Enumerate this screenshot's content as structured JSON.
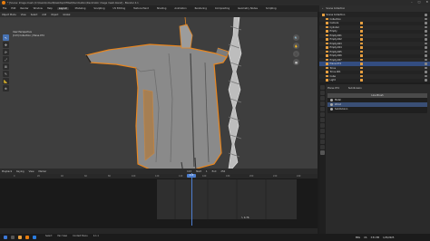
{
  "title_bar": {
    "title": "* [Scene: Image mesh (C:\\Users\\Inmed\\Desktop\\07Red\\Decimation\\Decimator image mesh.blend] - Blender 4.1",
    "min": "–",
    "max": "□",
    "close": "✕"
  },
  "menu": {
    "items": [
      "File",
      "Edit",
      "Render",
      "Window",
      "Help"
    ],
    "workspaces": [
      "Layout",
      "Modeling",
      "Sculpting",
      "UV Editing",
      "Texture Paint",
      "Shading",
      "Animation",
      "Rendering",
      "Compositing",
      "Geometry Nodes",
      "Scripting"
    ],
    "active_workspace": "Layout",
    "scene_label": "Scene",
    "view_layer_label": "ViewLayer"
  },
  "viewport": {
    "header": [
      "Object Mode",
      "View",
      "Select",
      "Add",
      "Object",
      "Global"
    ],
    "overlay_line1": "User Perspective",
    "overlay_line2": "(113) Collection | Plane.074",
    "tools": [
      "↖",
      "✥",
      "⟳",
      "⤢",
      "⊞",
      "✎",
      "📐",
      "⊕"
    ],
    "nav": [
      "🔍",
      "✋",
      "🎥",
      "▦"
    ]
  },
  "timeline": {
    "header": [
      "Playback",
      "Keying",
      "View",
      "Marker"
    ],
    "current_frame": "113",
    "start_label": "Start",
    "start": "1",
    "end_label": "End",
    "end": "250",
    "cursor_text": "↖ 4.76",
    "ruler_ticks": [
      "0",
      "20",
      "40",
      "60",
      "80",
      "100",
      "120",
      "140",
      "160",
      "180",
      "200",
      "220",
      "240"
    ]
  },
  "outliner": {
    "header": [
      "Scene Collection"
    ],
    "rows": [
      {
        "label": "Scene Collection",
        "selected": false
      },
      {
        "label": "Collection",
        "selected": false
      },
      {
        "label": "Camera",
        "selected": false
      },
      {
        "label": "Cylinder",
        "selected": false
      },
      {
        "label": "Empty",
        "selected": false
      },
      {
        "label": "Empty.001",
        "selected": false
      },
      {
        "label": "Empty.002",
        "selected": false
      },
      {
        "label": "Empty.003",
        "selected": false
      },
      {
        "label": "Empty.004",
        "selected": false
      },
      {
        "label": "Empty.005",
        "selected": false
      },
      {
        "label": "Empty.006",
        "selected": false
      },
      {
        "label": "Empty.007",
        "selected": false
      },
      {
        "label": "Plane.074",
        "selected": true
      },
      {
        "label": "Torus",
        "selected": false
      },
      {
        "label": "Torus.001",
        "selected": false
      },
      {
        "label": "Cube",
        "selected": false
      },
      {
        "label": "Light",
        "selected": false
      }
    ]
  },
  "properties": {
    "object_name": "Plane.074",
    "modifier_label": "Subdivision",
    "materials_header": "Line Brush",
    "materials": [
      "Metal",
      "Wood",
      "Subdivision"
    ],
    "selected_material_index": 1
  },
  "statusbar": {
    "items": [
      "Select",
      "Pan View",
      "Context Menu"
    ],
    "version": "4.1.1"
  },
  "tray": {
    "lang": "ENG",
    "region": "US",
    "time": "3:51 PM",
    "date": "1/25/2025"
  },
  "colors": {
    "accent": "#4772b3",
    "mesh_outline": "#e8861f",
    "mesh_fill": "#8a8a8a",
    "playhead": "#4e7fd0"
  }
}
